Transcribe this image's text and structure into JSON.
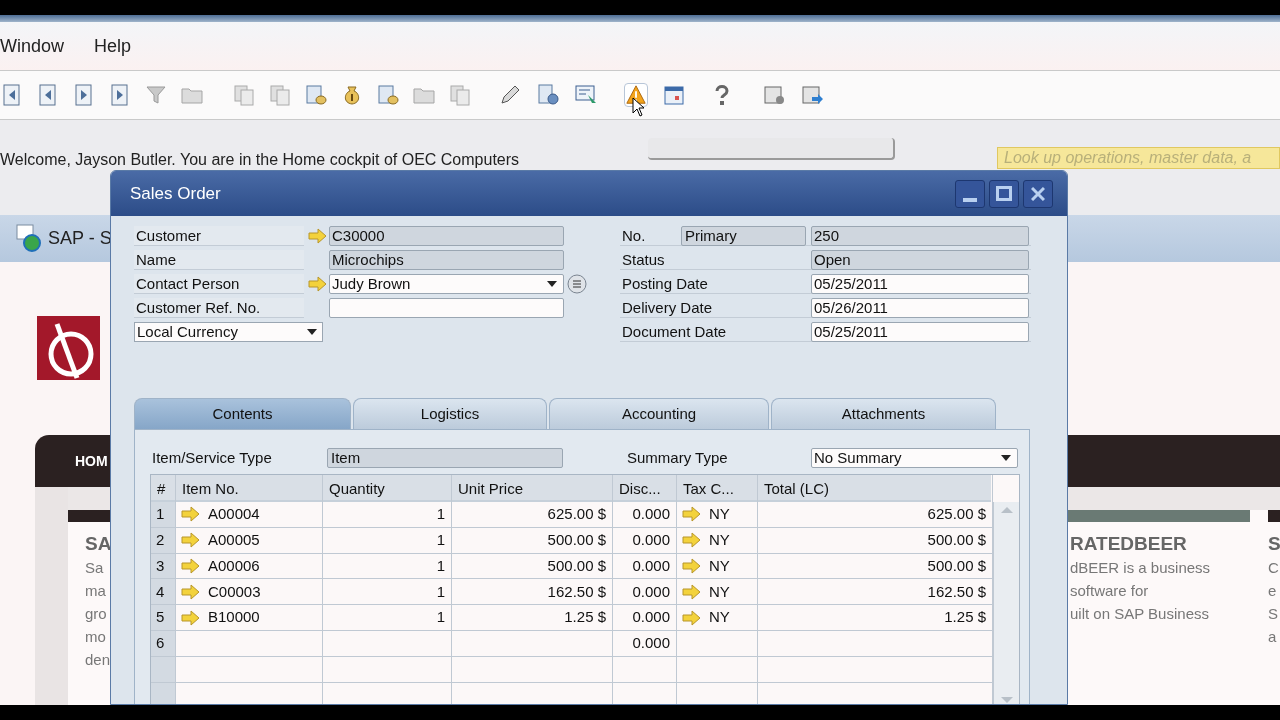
{
  "menu": [
    "Window",
    "Help"
  ],
  "welcome": "Welcome, Jayson Butler. You are in the Home cockpit of OEC Computers",
  "search": {
    "placeholder": "Look up operations, master data, a"
  },
  "cockpit_tab": "SAP - S",
  "nav": [
    "HOM"
  ],
  "cards": [
    {
      "heading": "SA",
      "lines": [
        "Sa",
        "ma",
        "gro",
        "mo",
        "den"
      ]
    },
    {
      "heading": "RATEDBEER",
      "lines": [
        "dBEER is a business",
        "software for",
        "uilt on SAP Business"
      ]
    },
    {
      "heading": "S",
      "lines": [
        "C",
        "e",
        "S",
        "a"
      ]
    }
  ],
  "dialog": {
    "title": "Sales Order",
    "header_left": [
      {
        "kind": "readonly",
        "label": "Customer",
        "value": "C30000",
        "link": true,
        "list_button": false
      },
      {
        "kind": "readonly",
        "label": "Name",
        "value": "Microchips",
        "link": false,
        "list_button": false
      },
      {
        "kind": "dropdown",
        "label": "Contact Person",
        "value": "Judy Brown",
        "link": true,
        "list_button": true
      },
      {
        "kind": "input",
        "label": "Customer Ref. No.",
        "link": false,
        "list_button": false
      },
      {
        "kind": "label_dropdown",
        "value": "Local Currency",
        "link": false,
        "list_button": false
      }
    ],
    "header_right": [
      {
        "kind": "readonly",
        "label": "No.",
        "series": "Primary",
        "value": "250"
      },
      {
        "kind": "readonly",
        "label": "Status",
        "value": "Open"
      },
      {
        "kind": "input",
        "label": "Posting Date",
        "value": "05/25/2011"
      },
      {
        "kind": "input",
        "label": "Delivery Date",
        "value": "05/26/2011"
      },
      {
        "kind": "input",
        "label": "Document Date",
        "value": "05/25/2011"
      }
    ],
    "tabs": [
      {
        "label": "Contents",
        "selected": true
      },
      {
        "label": "Logistics",
        "selected": false
      },
      {
        "label": "Accounting",
        "selected": false
      },
      {
        "label": "Attachments",
        "selected": false
      }
    ],
    "item_type": {
      "label": "Item/Service Type",
      "value": "Item"
    },
    "summary_type": {
      "label": "Summary Type",
      "value": "No Summary"
    },
    "grid": {
      "columns": [
        "#",
        "Item No.",
        "Quantity",
        "Unit Price",
        "Disc...",
        "Tax C...",
        "Total (LC)"
      ],
      "rows": [
        {
          "num": "1",
          "item": "A00004",
          "quantity": "1",
          "unit_price": "625.00 $",
          "discount": "0.000",
          "tax_code": "NY",
          "total": "625.00 $"
        },
        {
          "num": "2",
          "item": "A00005",
          "quantity": "1",
          "unit_price": "500.00 $",
          "discount": "0.000",
          "tax_code": "NY",
          "total": "500.00 $"
        },
        {
          "num": "3",
          "item": "A00006",
          "quantity": "1",
          "unit_price": "500.00 $",
          "discount": "0.000",
          "tax_code": "NY",
          "total": "500.00 $"
        },
        {
          "num": "4",
          "item": "C00003",
          "quantity": "1",
          "unit_price": "162.50 $",
          "discount": "0.000",
          "tax_code": "NY",
          "total": "162.50 $"
        },
        {
          "num": "5",
          "item": "B10000",
          "quantity": "1",
          "unit_price": "1.25 $",
          "discount": "0.000",
          "tax_code": "NY",
          "total": "1.25 $"
        },
        {
          "num": "6",
          "discount": "0.000"
        }
      ]
    }
  }
}
